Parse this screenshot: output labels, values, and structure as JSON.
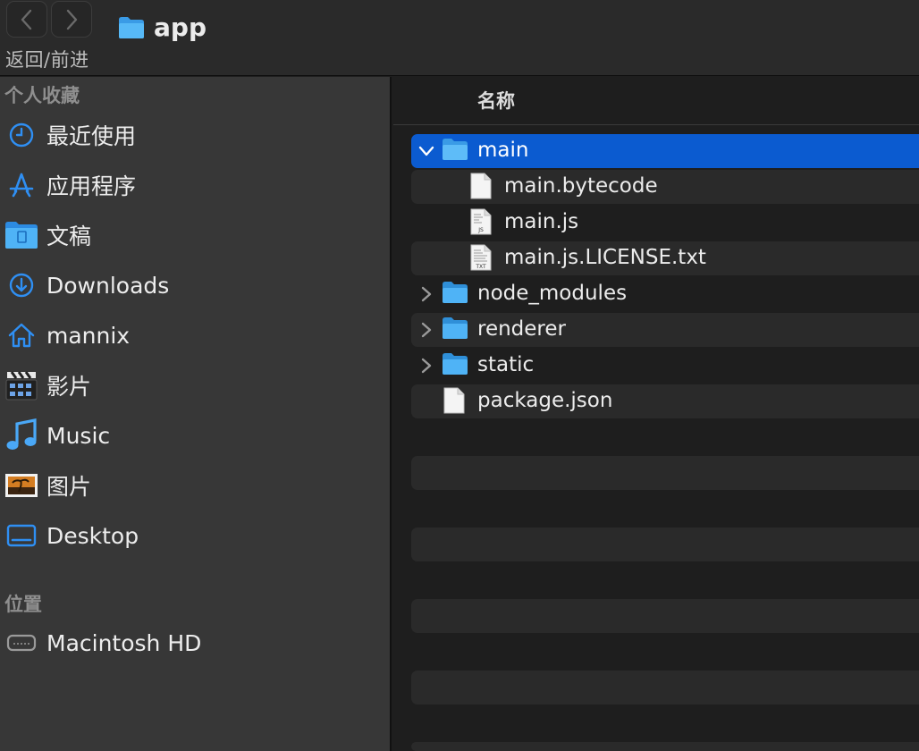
{
  "toolbar": {
    "back_label": "<",
    "forward_label": ">",
    "nav_caption": "返回/前进",
    "window_title": "app",
    "folder_icon": "folder-icon"
  },
  "sidebar": {
    "favorites_header": "个人收藏",
    "favorites": [
      {
        "label": "最近使用",
        "icon": "clock-icon"
      },
      {
        "label": "应用程序",
        "icon": "applications-icon"
      },
      {
        "label": "文稿",
        "icon": "documents-folder-icon"
      },
      {
        "label": "Downloads",
        "icon": "download-icon"
      },
      {
        "label": "mannix",
        "icon": "home-icon"
      },
      {
        "label": "影片",
        "icon": "movies-clapper-icon"
      },
      {
        "label": "Music",
        "icon": "music-note-icon"
      },
      {
        "label": "图片",
        "icon": "pictures-icon"
      },
      {
        "label": "Desktop",
        "icon": "desktop-icon"
      }
    ],
    "locations_header": "位置",
    "locations": [
      {
        "label": "Macintosh HD",
        "icon": "hard-drive-icon"
      }
    ]
  },
  "content": {
    "column_header": "名称",
    "rows": [
      {
        "label": "main",
        "kind": "folder",
        "expanded": true,
        "selected": true
      },
      {
        "label": "main.bytecode",
        "kind": "file",
        "depth": 1
      },
      {
        "label": "main.js",
        "kind": "js-file",
        "badge": "JS",
        "depth": 1
      },
      {
        "label": "main.js.LICENSE.txt",
        "kind": "txt-file",
        "badge": "TXT",
        "depth": 1
      },
      {
        "label": "node_modules",
        "kind": "folder",
        "expanded": false
      },
      {
        "label": "renderer",
        "kind": "folder",
        "expanded": false
      },
      {
        "label": "static",
        "kind": "folder",
        "expanded": false
      },
      {
        "label": "package.json",
        "kind": "file"
      }
    ]
  },
  "colors": {
    "accent_selection": "#0b5bd0",
    "folder_blue": "#4fb3f6",
    "sidebar_icon_blue": "#2f8ff3"
  }
}
